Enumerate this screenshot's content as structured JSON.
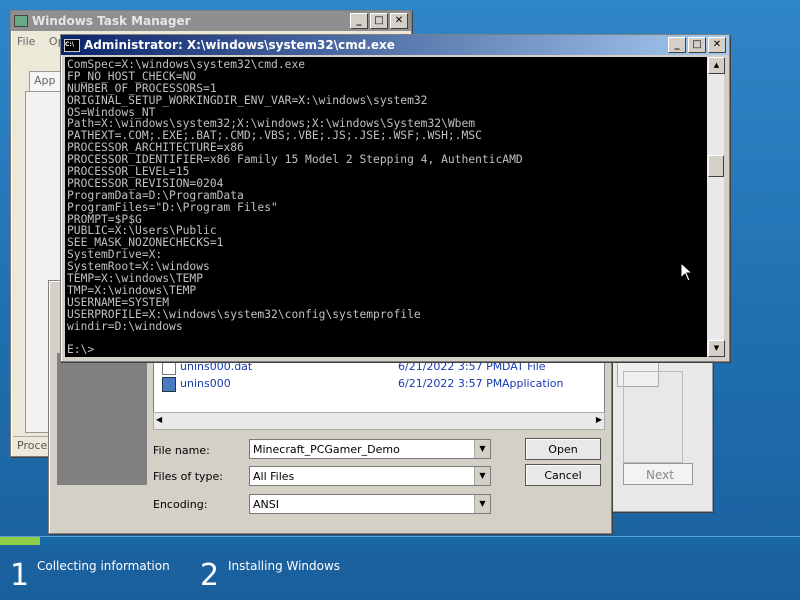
{
  "setup": {
    "steps": [
      {
        "num": "1",
        "label": "Collecting information"
      },
      {
        "num": "2",
        "label": "Installing Windows"
      }
    ],
    "progress_fraction": 0.05,
    "colors": {
      "background": "#1f6fb0",
      "progress": "#8fcf47"
    }
  },
  "taskmgr": {
    "title": "Windows Task Manager",
    "menu_file": "File",
    "menu_options": "Op",
    "tab_label": "App",
    "status": "Proces"
  },
  "wizard": {
    "next_label": "Next"
  },
  "file_dialog": {
    "files": [
      {
        "name": "unins000.dat",
        "date": "6/21/2022 3:57 PM",
        "type": "DAT File",
        "icon": "document-icon"
      },
      {
        "name": "unins000",
        "date": "6/21/2022 3:57 PM",
        "type": "Application",
        "icon": "installer-icon"
      }
    ],
    "file_name_label": "File name:",
    "file_name_value": "Minecraft_PCGamer_Demo",
    "file_type_label": "Files of type:",
    "file_type_value": "All Files",
    "encoding_label": "Encoding:",
    "encoding_value": "ANSI",
    "open_label": "Open",
    "cancel_label": "Cancel"
  },
  "cmd": {
    "title": "Administrator: X:\\windows\\system32\\cmd.exe",
    "lines": [
      "ComSpec=X:\\windows\\system32\\cmd.exe",
      "FP_NO_HOST_CHECK=NO",
      "NUMBER_OF_PROCESSORS=1",
      "ORIGINAL_SETUP_WORKINGDIR_ENV_VAR=X:\\windows\\system32",
      "OS=Windows_NT",
      "Path=X:\\windows\\system32;X:\\windows;X:\\windows\\System32\\Wbem",
      "PATHEXT=.COM;.EXE;.BAT;.CMD;.VBS;.VBE;.JS;.JSE;.WSF;.WSH;.MSC",
      "PROCESSOR_ARCHITECTURE=x86",
      "PROCESSOR_IDENTIFIER=x86 Family 15 Model 2 Stepping 4, AuthenticAMD",
      "PROCESSOR_LEVEL=15",
      "PROCESSOR_REVISION=0204",
      "ProgramData=D:\\ProgramData",
      "ProgramFiles=\"D:\\Program Files\"",
      "PROMPT=$P$G",
      "PUBLIC=X:\\Users\\Public",
      "SEE_MASK_NOZONECHECKS=1",
      "SystemDrive=X:",
      "SystemRoot=X:\\windows",
      "TEMP=X:\\windows\\TEMP",
      "TMP=X:\\windows\\TEMP",
      "USERNAME=SYSTEM",
      "USERPROFILE=X:\\windows\\system32\\config\\systemprofile",
      "windir=D:\\windows",
      "",
      "E:\\>"
    ]
  }
}
